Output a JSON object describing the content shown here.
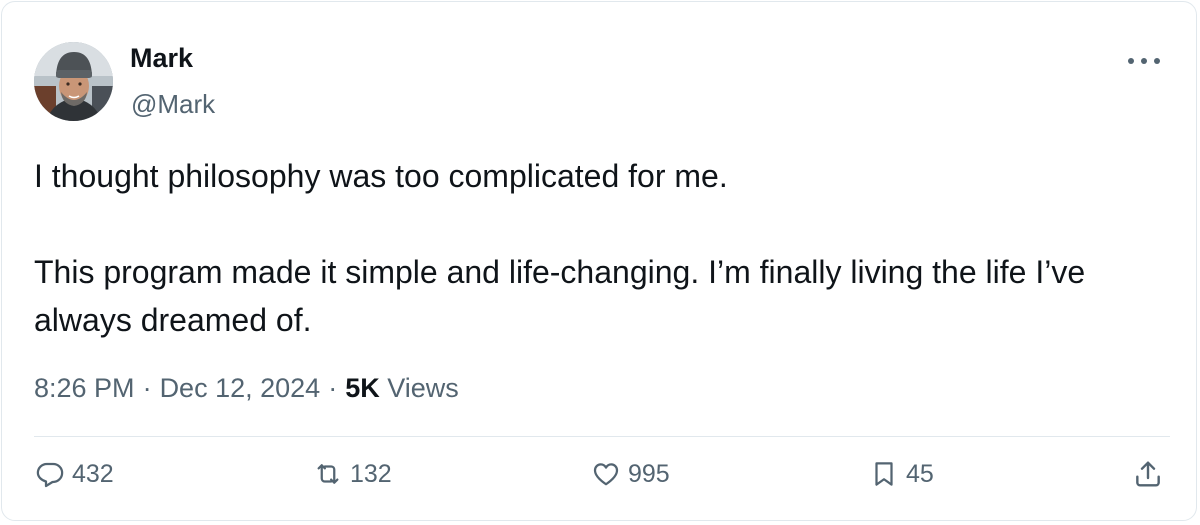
{
  "author": {
    "name": "Mark",
    "handle": "@Mark",
    "avatar": "avatar-photo-man-beanie"
  },
  "tweet": {
    "paragraphs": [
      "I thought philosophy was too complicated for me.",
      "This program made it simple and life-changing. I’m finally living the life I’ve always dreamed of."
    ]
  },
  "meta": {
    "time": "8:26 PM",
    "separator": "·",
    "date": "Dec 12, 2024",
    "views_count": "5K",
    "views_label": "Views"
  },
  "actions": {
    "replies": "432",
    "retweets": "132",
    "likes": "995",
    "bookmarks": "45"
  },
  "icons": {
    "more": "more-horizontal-icon",
    "reply": "reply-bubble-icon",
    "retweet": "retweet-icon",
    "like": "heart-icon",
    "bookmark": "bookmark-icon",
    "share": "share-upload-icon"
  },
  "colors": {
    "text_primary": "#0f1419",
    "text_secondary": "#536471",
    "border": "#e1e8ed"
  }
}
